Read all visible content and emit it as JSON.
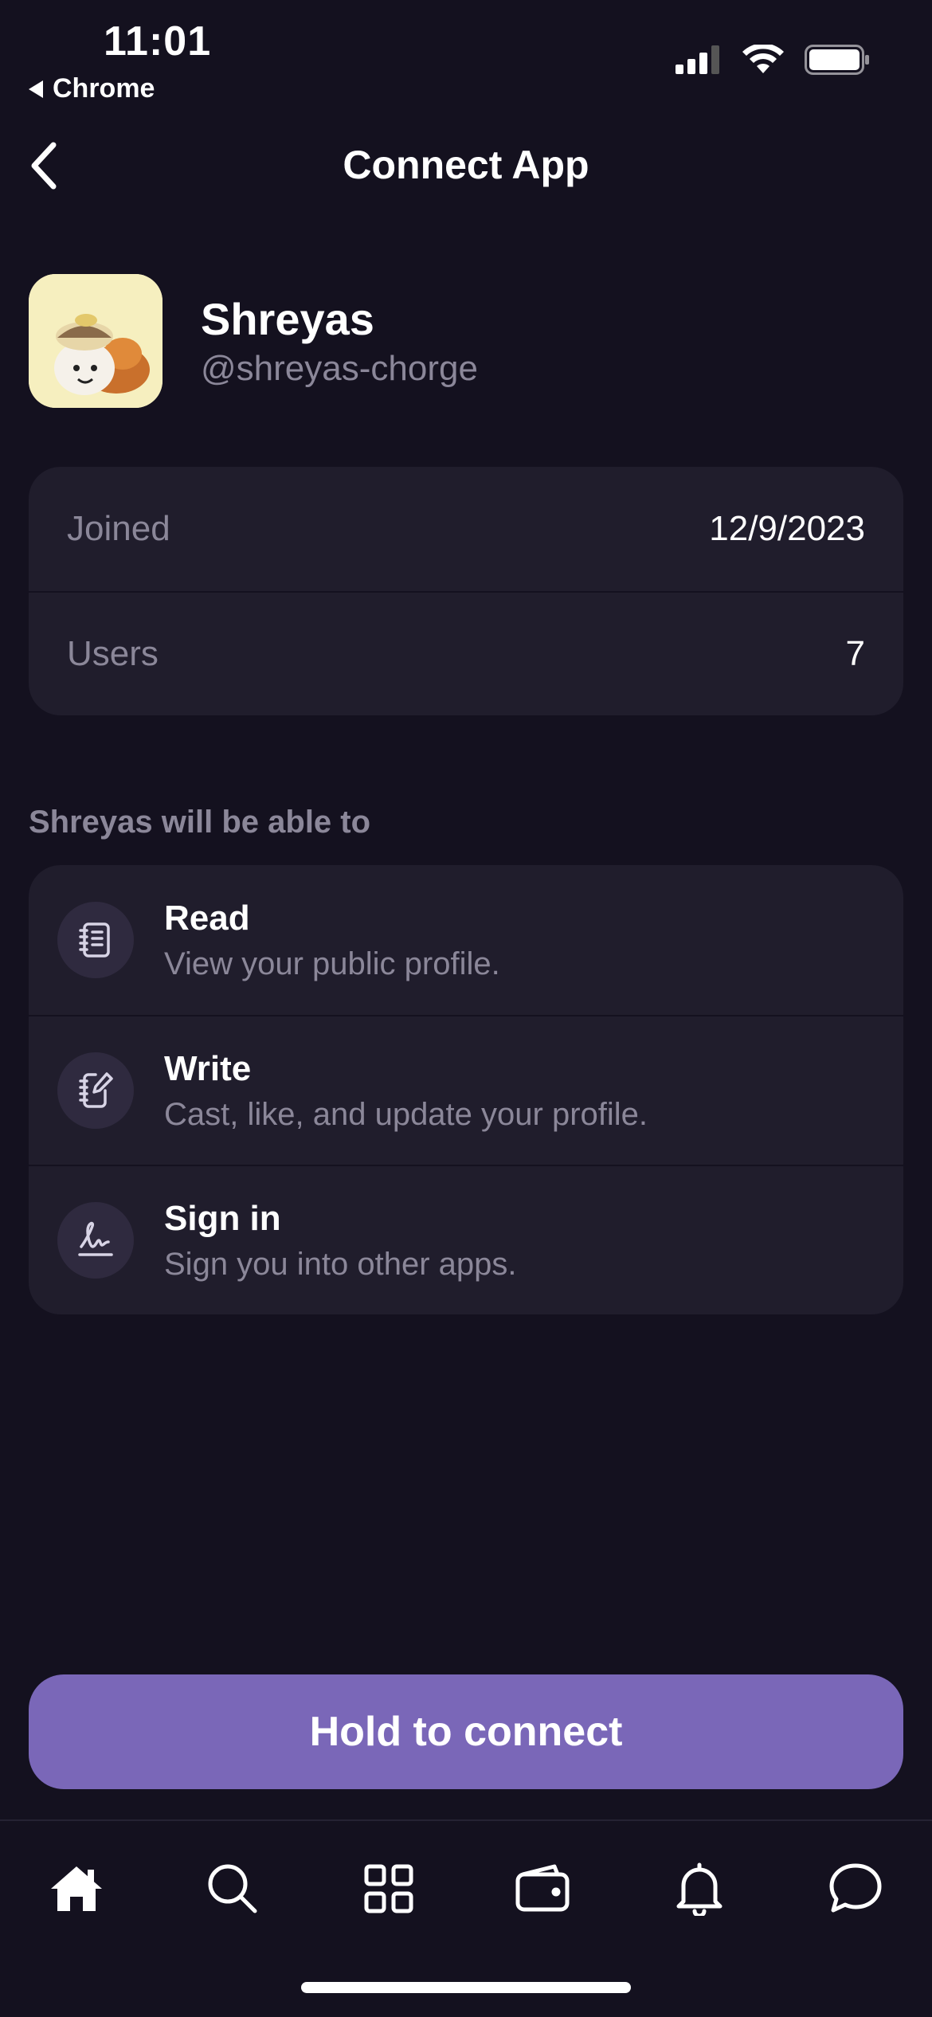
{
  "status_bar": {
    "time": "11:01",
    "back_app": "Chrome",
    "icons": [
      "signal-icon",
      "wifi-icon",
      "battery-icon"
    ]
  },
  "nav": {
    "title": "Connect App",
    "back_icon": "chevron-left-icon"
  },
  "profile": {
    "name": "Shreyas",
    "handle": "@shreyas-chorge",
    "avatar": "avatar-illustration"
  },
  "info": [
    {
      "label": "Joined",
      "value": "12/9/2023"
    },
    {
      "label": "Users",
      "value": "7"
    }
  ],
  "permissions": {
    "heading": "Shreyas will be able to",
    "items": [
      {
        "title": "Read",
        "description": "View your public profile.",
        "icon": "notebook-icon"
      },
      {
        "title": "Write",
        "description": "Cast, like, and update your profile.",
        "icon": "edit-note-icon"
      },
      {
        "title": "Sign in",
        "description": "Sign you into other apps.",
        "icon": "signature-icon"
      }
    ]
  },
  "cta": {
    "label": "Hold to connect"
  },
  "tabbar": {
    "items": [
      "home-icon",
      "search-icon",
      "grid-icon",
      "wallet-icon",
      "bell-icon",
      "chat-icon"
    ],
    "active": "home-icon"
  },
  "colors": {
    "background": "#14111f",
    "card": "#201d2c",
    "accent": "#7a67b8",
    "muted_text": "#8b8799"
  }
}
